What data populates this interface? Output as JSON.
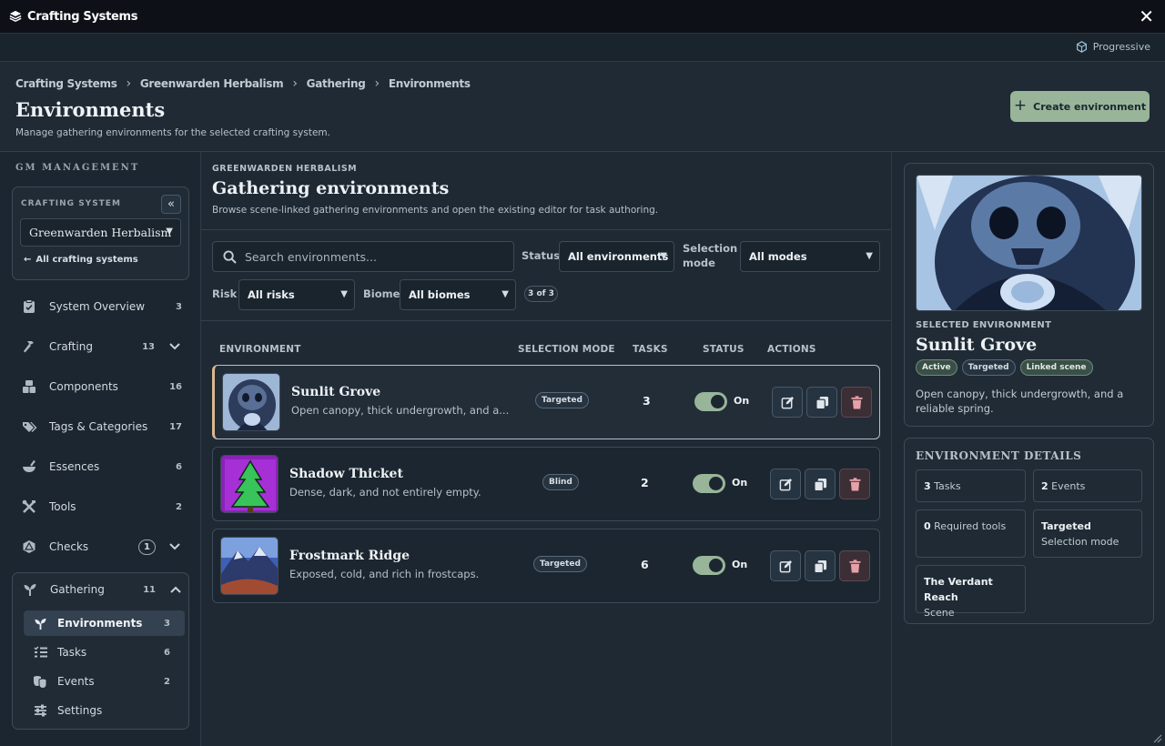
{
  "window": {
    "title": "Crafting Systems"
  },
  "subbar": {
    "mode_label": "Progressive"
  },
  "header": {
    "breadcrumbs": [
      "Crafting Systems",
      "Greenwarden Herbalism",
      "Gathering",
      "Environments"
    ],
    "title": "Environments",
    "subtitle": "Manage gathering environments for the selected crafting system.",
    "create_button": "Create environment"
  },
  "sidebar": {
    "section_label": "GM MANAGEMENT",
    "crafting_system_label": "CRAFTING SYSTEM",
    "selected_system": "Greenwarden Herbalism",
    "all_systems_link": "All crafting systems",
    "items": [
      {
        "label": "System Overview",
        "count": "3",
        "icon": "clipboard-check-icon"
      },
      {
        "label": "Crafting",
        "count": "13",
        "icon": "hammer-icon",
        "expandable": true
      },
      {
        "label": "Components",
        "count": "16",
        "icon": "boxes-icon"
      },
      {
        "label": "Tags & Categories",
        "count": "17",
        "icon": "tags-icon"
      },
      {
        "label": "Essences",
        "count": "6",
        "icon": "mortar-icon"
      },
      {
        "label": "Tools",
        "count": "2",
        "icon": "tools-icon"
      },
      {
        "label": "Checks",
        "count": "1",
        "icon": "d20-icon",
        "expandable": true
      },
      {
        "label": "Gathering",
        "count": "11",
        "icon": "sprout-icon",
        "expanded": true
      }
    ],
    "gathering_subitems": [
      {
        "label": "Environments",
        "count": "3",
        "icon": "sprout-icon",
        "active": true
      },
      {
        "label": "Tasks",
        "count": "6",
        "icon": "list-check-icon"
      },
      {
        "label": "Events",
        "count": "2",
        "icon": "masks-icon"
      },
      {
        "label": "Settings",
        "count": "",
        "icon": "sliders-icon"
      }
    ]
  },
  "main": {
    "kicker": "GREENWARDEN HERBALISM",
    "title": "Gathering environments",
    "subtitle": "Browse scene-linked gathering environments and open the existing editor for task authoring.",
    "search_placeholder": "Search environments...",
    "filters": {
      "status_label": "Status",
      "status_value": "All environments",
      "mode_label_line1": "Selection",
      "mode_label_line2": "mode",
      "mode_value": "All modes",
      "risk_label": "Risk",
      "risk_value": "All risks",
      "biome_label": "Biome",
      "biome_value": "All biomes",
      "result_count": "3 of 3"
    },
    "columns": [
      "ENVIRONMENT",
      "SELECTION MODE",
      "TASKS",
      "STATUS",
      "ACTIONS"
    ],
    "rows": [
      {
        "name": "Sunlit Grove",
        "desc": "Open canopy, thick undergrowth, and a...",
        "mode": "Targeted",
        "tasks": "3",
        "status": "On",
        "enabled": true,
        "selected": true
      },
      {
        "name": "Shadow Thicket",
        "desc": "Dense, dark, and not entirely empty.",
        "mode": "Blind",
        "tasks": "2",
        "status": "On",
        "enabled": true,
        "selected": false
      },
      {
        "name": "Frostmark Ridge",
        "desc": "Exposed, cold, and rich in frostcaps.",
        "mode": "Targeted",
        "tasks": "6",
        "status": "On",
        "enabled": true,
        "selected": false
      }
    ]
  },
  "selected": {
    "kicker": "SELECTED ENVIRONMENT",
    "title": "Sunlit Grove",
    "badges": [
      "Active",
      "Targeted",
      "Linked scene"
    ],
    "desc": "Open canopy, thick undergrowth, and a reliable spring."
  },
  "details": {
    "title": "ENVIRONMENT DETAILS",
    "tasks_value": "3",
    "tasks_label": "Tasks",
    "events_value": "2",
    "events_label": "Events",
    "tools_value": "0",
    "tools_label": "Required tools",
    "mode_value": "Targeted",
    "mode_label": "Selection mode",
    "scene_value": "The Verdant Reach",
    "scene_label": "Scene"
  },
  "colors": {
    "accent": "#98b59a",
    "highlight": "#d9b98f",
    "background": "#1e2933"
  }
}
